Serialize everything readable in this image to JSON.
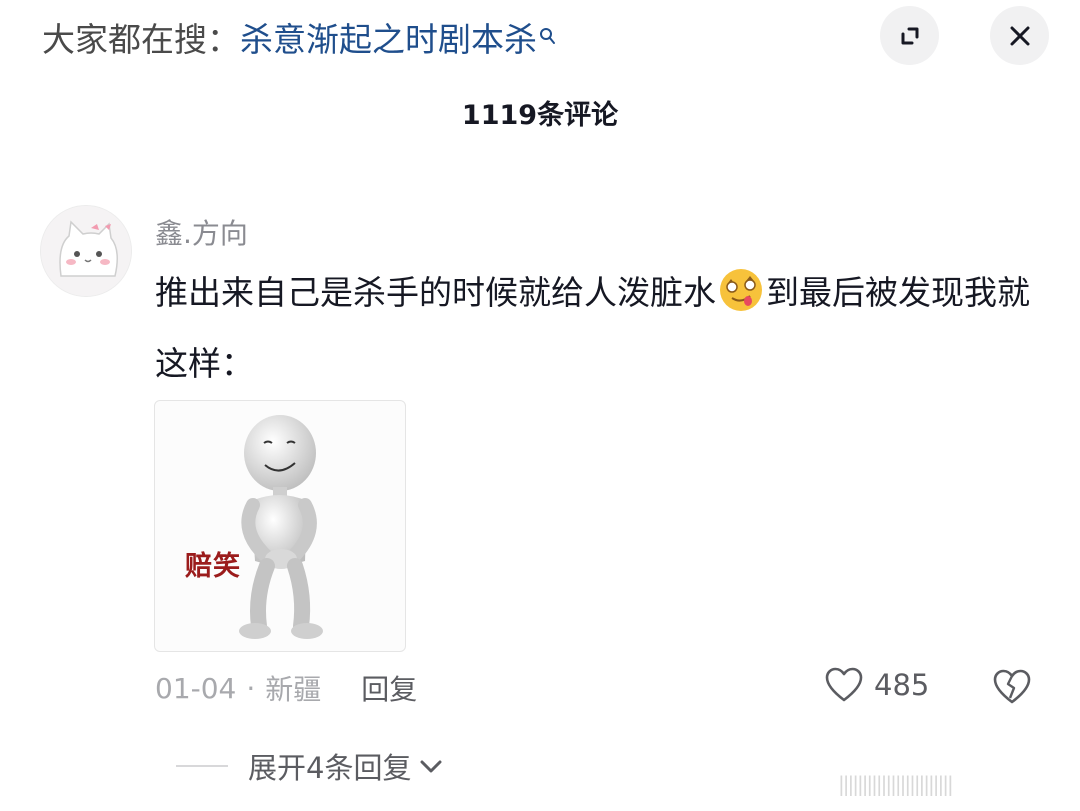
{
  "search": {
    "prefix": "大家都在搜：",
    "term": "杀意渐起之时剧本杀"
  },
  "comments": {
    "count_label": "1119条评论"
  },
  "comment": {
    "username": "鑫.方向",
    "text_before_emoji": "推出来自己是杀手的时候就给人泼脏水",
    "text_after_emoji": "到最后被发现我就这样：",
    "emoji_icon": "dizzy-tongue-emoji",
    "image_caption": "赔笑",
    "date": "01-04",
    "separator": "·",
    "location": "新疆",
    "reply_label": "回复",
    "like_count": "485",
    "expand_replies_label": "展开4条回复"
  },
  "watermark": "||||||||||||||||||||||||",
  "colors": {
    "link_blue": "#1f4e8c",
    "primary_text": "#161823",
    "secondary_text": "#a8a9ad",
    "button_bg": "#f1f1f2"
  }
}
